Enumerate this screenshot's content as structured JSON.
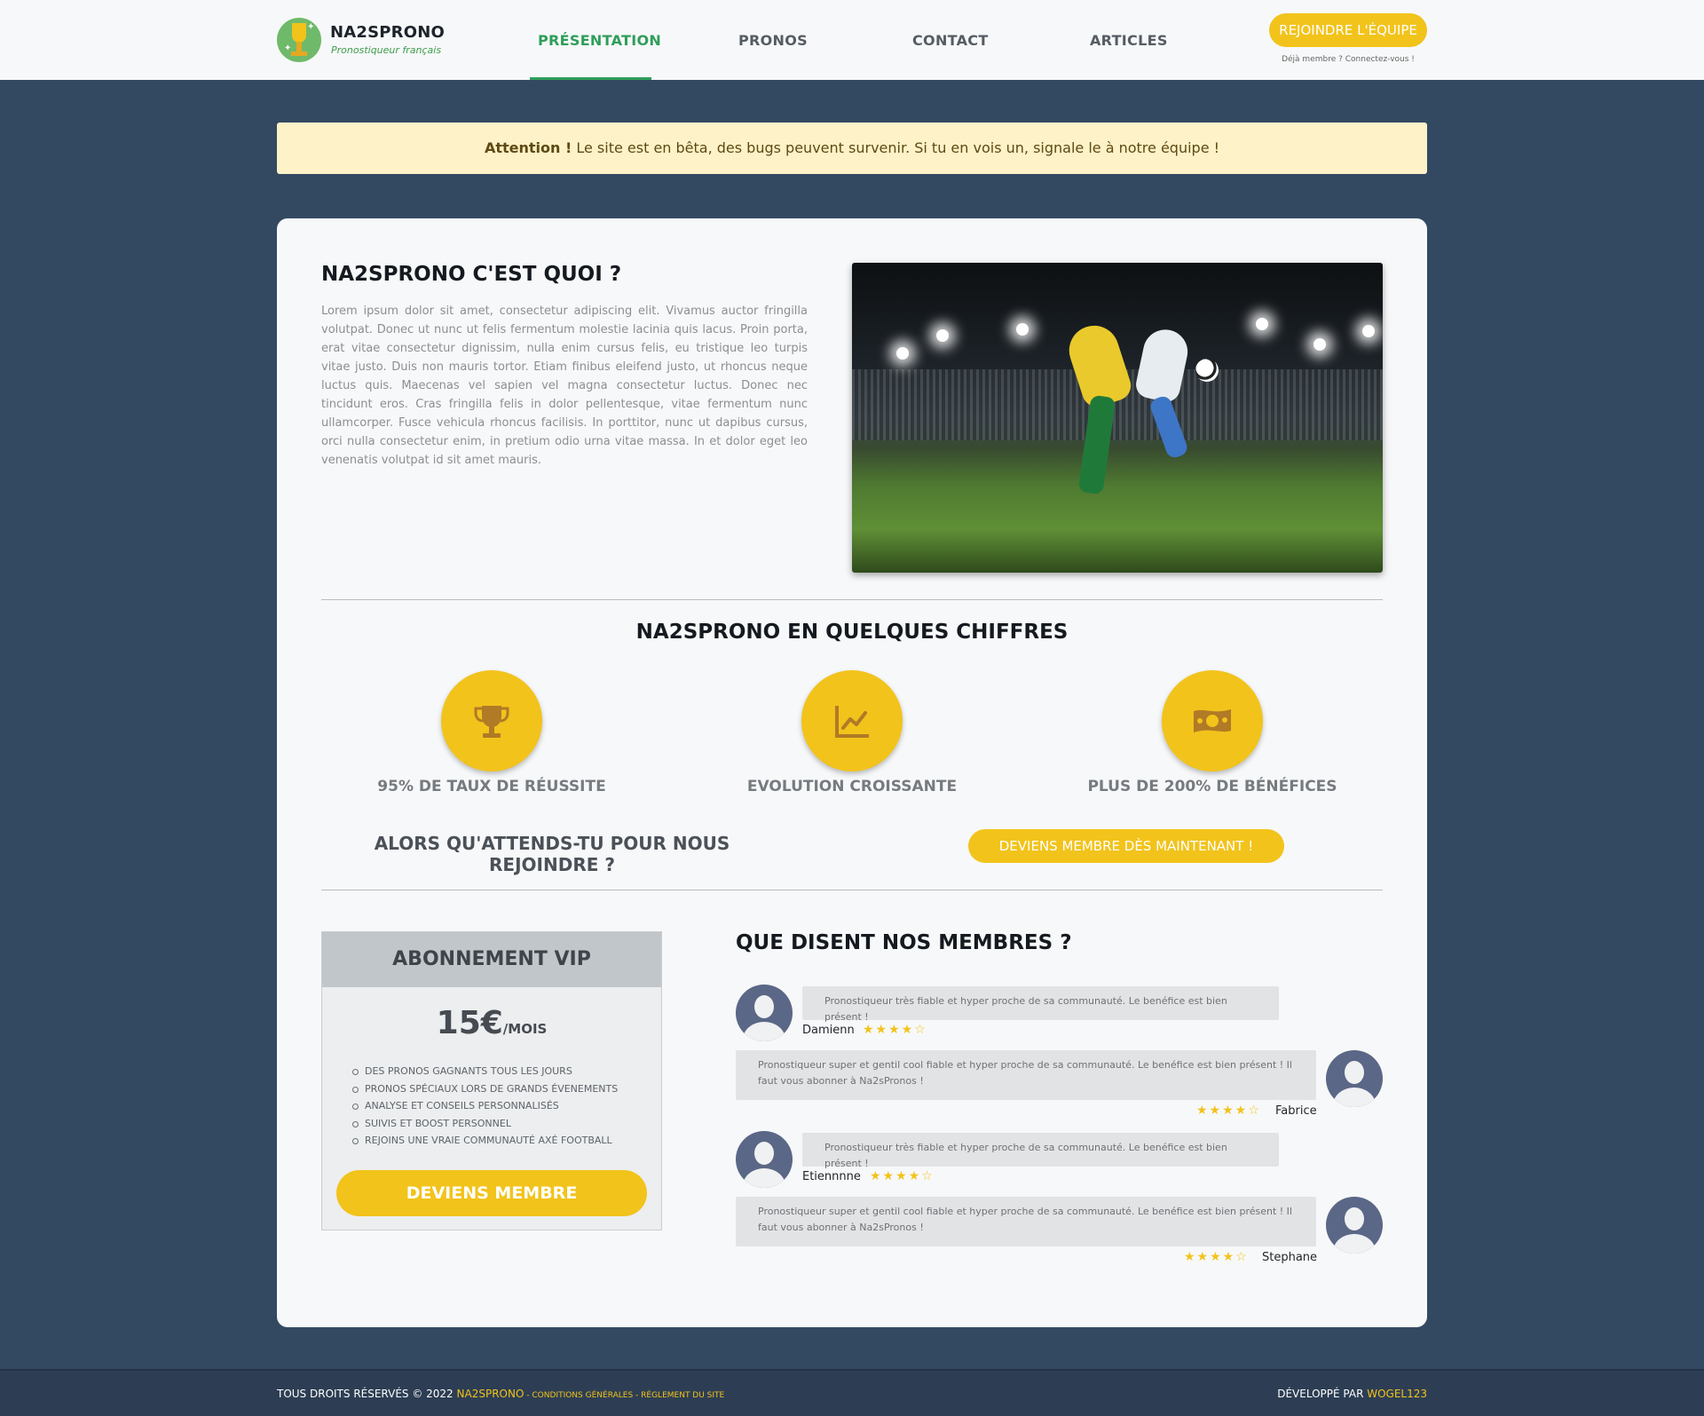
{
  "header": {
    "brand_name": "NA2SPRONO",
    "brand_tagline": "Pronostiqueur français",
    "nav": [
      {
        "label": "PRÉSENTATION",
        "active": true
      },
      {
        "label": "PRONOS",
        "active": false
      },
      {
        "label": "CONTACT",
        "active": false
      },
      {
        "label": "ARTICLES",
        "active": false
      }
    ],
    "join_button": "REJOINDRE L'ÉQUIPE",
    "already_member": "Déjà membre ? Connectez-vous !"
  },
  "alert": {
    "strong": "Attention !",
    "text": " Le site est en bêta, des bugs peuvent survenir. Si tu en vois un, signale le à notre équipe !"
  },
  "about": {
    "title": "NA2SPRONO C'EST QUOI ?",
    "text": "Lorem ipsum dolor sit amet, consectetur adipiscing elit. Vivamus auctor fringilla volutpat. Donec ut nunc ut felis fermentum molestie lacinia quis lacus. Proin porta, erat vitae consectetur dignissim, nulla enim cursus felis, eu tristique leo turpis vitae justo. Duis non mauris tortor. Etiam finibus eleifend justo, ut rhoncus neque luctus quis. Maecenas vel sapien vel magna consectetur luctus. Donec nec tincidunt eros. Cras fringilla felis in dolor pellentesque, vitae fermentum nunc ullamcorper. Fusce vehicula rhoncus facilisis. In porttitor, nunc ut dapibus cursus, orci nulla consectetur enim, in pretium odio urna vitae massa. In et dolor eget leo venenatis volutpat id sit amet mauris."
  },
  "stats": {
    "title": "NA2SPRONO EN QUELQUES CHIFFRES",
    "items": [
      {
        "icon": "trophy-icon",
        "label": "95% DE TAUX DE RÉUSSITE"
      },
      {
        "icon": "chart-line-icon",
        "label": "EVOLUTION CROISSANTE"
      },
      {
        "icon": "money-bill-icon",
        "label": "PLUS DE 200% DE BÉNÉFICES"
      }
    ],
    "cta_text": "ALORS QU'ATTENDS-TU POUR NOUS REJOINDRE ?",
    "cta_button": "DEVIENS MEMBRE DÈS MAINTENANT !"
  },
  "vip": {
    "title": "ABONNEMENT VIP",
    "price": "15€",
    "period": "/MOIS",
    "features": [
      "DES PRONOS GAGNANTS TOUS LES JOURS",
      "PRONOS SPÉCIAUX LORS DE GRANDS ÉVENEMENTS",
      "ANALYSE ET CONSEILS PERSONNALISÉS",
      "SUIVIS ET BOOST PERSONNEL",
      "REJOINS UNE VRAIE COMMUNAUTÉ AXÉ FOOTBALL"
    ],
    "button": "DEVIENS MEMBRE"
  },
  "testimonials": {
    "title": "QUE DISENT NOS MEMBRES ?",
    "items": [
      {
        "name": "Damienn",
        "rating": 4,
        "text": "Pronostiqueur très fiable et hyper proche de sa communauté. Le benéfice est bien présent !"
      },
      {
        "name": "Fabrice",
        "rating": 4,
        "text": "Pronostiqueur super et gentil cool fiable et hyper proche de sa communauté. Le benéfice est bien présent ! Il faut vous abonner à Na2sPronos !"
      },
      {
        "name": "Etiennnne",
        "rating": 4,
        "text": "Pronostiqueur très fiable et hyper proche de sa communauté. Le benéfice est bien présent !"
      },
      {
        "name": "Stephane",
        "rating": 4,
        "text": "Pronostiqueur super et gentil cool fiable et hyper proche de sa communauté. Le benéfice est bien présent ! Il faut vous abonner à Na2sPronos !"
      }
    ]
  },
  "footer": {
    "rights": "TOUS DROITS RÉSERVÉS © 2022 ",
    "brand": "NA2SPRONO",
    "sep": " - ",
    "cgu": "CONDITIONS GÉNÉRALES",
    "reglement": "RÉGLEMENT DU SITE",
    "dev_label": "DÉVELOPPÉ PAR ",
    "dev_name": "WOGEL123"
  },
  "colors": {
    "background": "#334962",
    "accent_yellow": "#f2c31b",
    "accent_green": "#2f9e5b",
    "alert_bg": "#fdf2c8"
  }
}
